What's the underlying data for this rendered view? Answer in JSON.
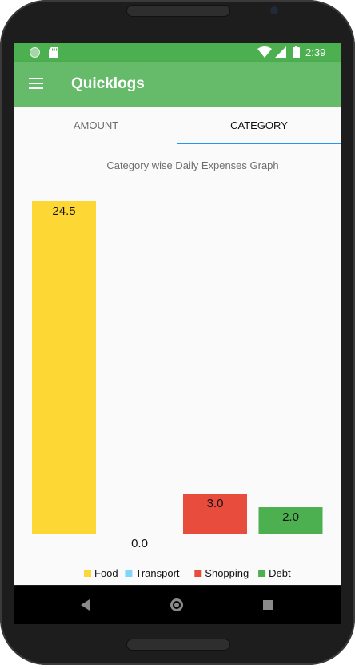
{
  "status_bar": {
    "time": "2:39",
    "left_icons": [
      "circle-notification-icon",
      "sd-card-icon"
    ],
    "right_icons": [
      "wifi-icon",
      "signal-icon",
      "battery-icon"
    ],
    "color": "#4caf50"
  },
  "app_bar": {
    "title": "Quicklogs",
    "menu_icon": "hamburger-menu-icon",
    "color": "#66bb6a"
  },
  "tabs": [
    {
      "label": "AMOUNT",
      "active": false
    },
    {
      "label": "CATEGORY",
      "active": true
    }
  ],
  "tab_indicator_color": "#2196f3",
  "chart_data": {
    "type": "bar",
    "title": "Category wise Daily Expenses Graph",
    "categories": [
      "Food",
      "Transport",
      "Shopping",
      "Debt"
    ],
    "values": [
      24.5,
      0.0,
      3.0,
      2.0
    ],
    "value_labels": [
      "24.5",
      "0.0",
      "3.0",
      "2.0"
    ],
    "colors": [
      "#fdd835",
      "#81d4fa",
      "#e74c3c",
      "#4caf50"
    ],
    "ylim": [
      0,
      24.5
    ],
    "grid": false,
    "legend": "bottom",
    "xlabel": "",
    "ylabel": ""
  },
  "nav_bar": {
    "buttons": [
      "back-icon",
      "home-icon",
      "recents-icon"
    ]
  }
}
